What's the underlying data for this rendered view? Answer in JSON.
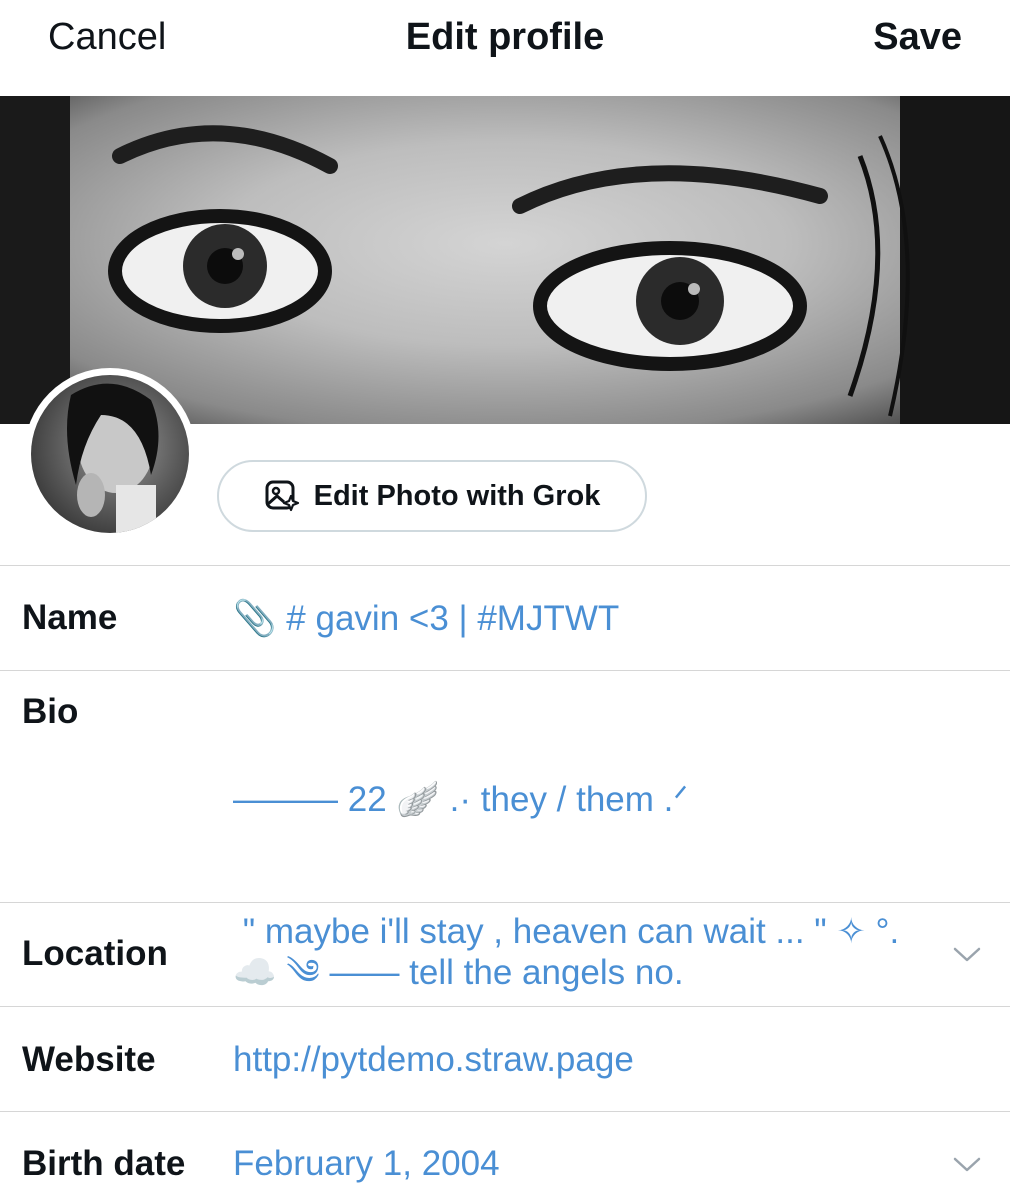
{
  "header": {
    "cancel_label": "Cancel",
    "title": "Edit profile",
    "save_label": "Save"
  },
  "grok_button": {
    "label": "Edit Photo with Grok",
    "icon": "image-sparkle-icon"
  },
  "fields": {
    "name": {
      "label": "Name",
      "value": "📎 # gavin <3 | #MJTWT"
    },
    "bio": {
      "label": "Bio",
      "line1": "——— 22 🪽 .· they / them .ᐟ",
      "line2": " \" maybe i'll stay , heaven can wait ... \" ✧ °."
    },
    "location": {
      "label": "Location",
      "value": "☁️ ༄ ——  tell the angels no."
    },
    "website": {
      "label": "Website",
      "value": "http://pytdemo.straw.page"
    },
    "birth_date": {
      "label": "Birth date",
      "value": "February 1, 2004"
    }
  },
  "colors": {
    "text": "#0f1419",
    "link_value": "#4a8fd4",
    "divider": "#d6d6d6",
    "button_border": "#cfd9de"
  }
}
